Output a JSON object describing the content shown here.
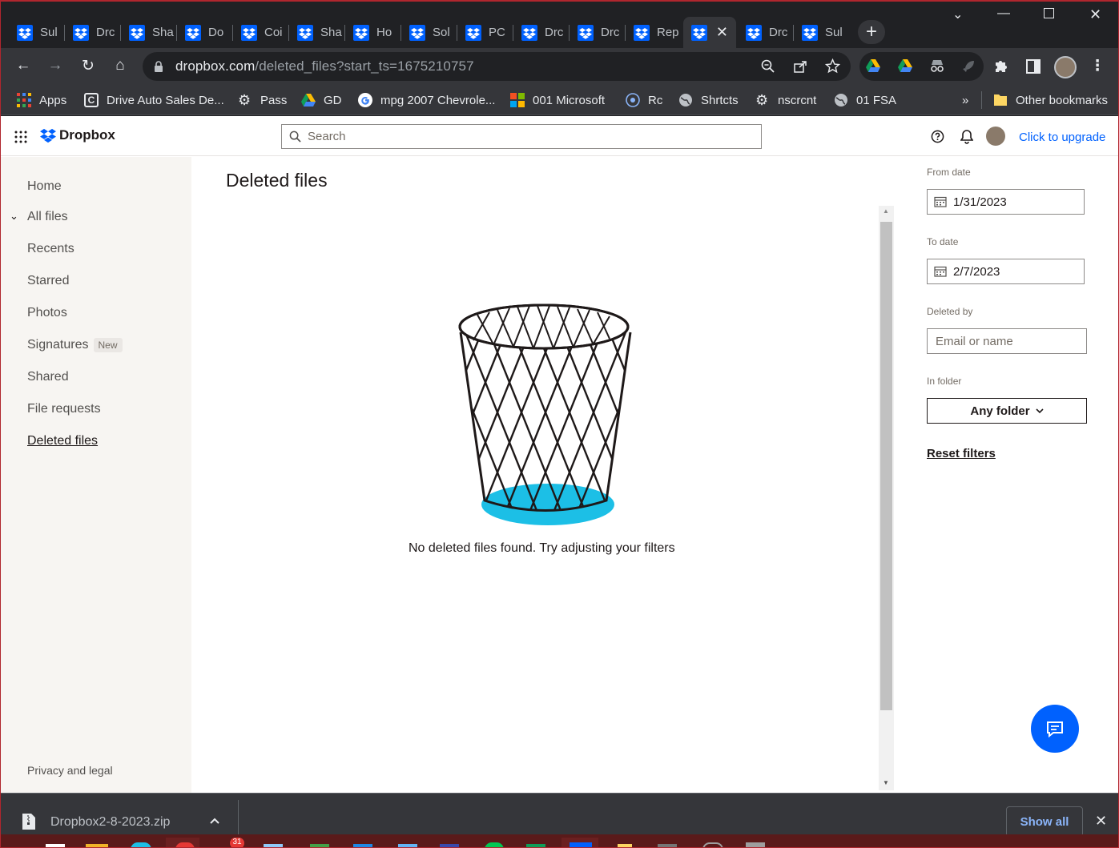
{
  "tabs": [
    {
      "label": "Sul"
    },
    {
      "label": "Drc"
    },
    {
      "label": "Sha"
    },
    {
      "label": "Do"
    },
    {
      "label": "Coi"
    },
    {
      "label": "Sha"
    },
    {
      "label": "Ho"
    },
    {
      "label": "Sol"
    },
    {
      "label": "PC"
    },
    {
      "label": "Drc"
    },
    {
      "label": "Drc"
    },
    {
      "label": "Rep"
    },
    {
      "label": ""
    },
    {
      "label": "Drc"
    },
    {
      "label": "Sul"
    }
  ],
  "address_bar": {
    "host": "dropbox.com",
    "path": "/deleted_files?start_ts=1675210757"
  },
  "bookmarks": {
    "apps": "Apps",
    "items": [
      "Drive Auto Sales De...",
      "Pass",
      "GD",
      "mpg 2007 Chevrole...",
      "001 Microsoft",
      "Rc",
      "Shrtcts",
      "nscrcnt",
      "01 FSA"
    ],
    "overflow": "»",
    "other": "Other bookmarks"
  },
  "dropbox": {
    "brand": "Dropbox",
    "search_placeholder": "Search",
    "upgrade": "Click to upgrade",
    "nav": {
      "home": "Home",
      "all_files": "All files",
      "recents": "Recents",
      "starred": "Starred",
      "photos": "Photos",
      "signatures": "Signatures",
      "signatures_badge": "New",
      "shared": "Shared",
      "file_requests": "File requests",
      "deleted_files": "Deleted files",
      "privacy": "Privacy and legal"
    },
    "title": "Deleted files",
    "empty_message": "No deleted files found. Try adjusting your filters",
    "filters": {
      "from_label": "From date",
      "from_value": "1/31/2023",
      "to_label": "To date",
      "to_value": "2/7/2023",
      "deleted_by_label": "Deleted by",
      "deleted_by_placeholder": "Email or name",
      "folder_label": "In folder",
      "folder_value": "Any folder",
      "reset": "Reset filters"
    }
  },
  "downloads": {
    "file": "Dropbox2-8-2023.zip",
    "show_all": "Show all"
  },
  "colors": {
    "brand": "#0061fe",
    "accent_cyan": "#1cbfe6",
    "chrome_dark": "#202124",
    "chrome_mid": "#35363a"
  }
}
